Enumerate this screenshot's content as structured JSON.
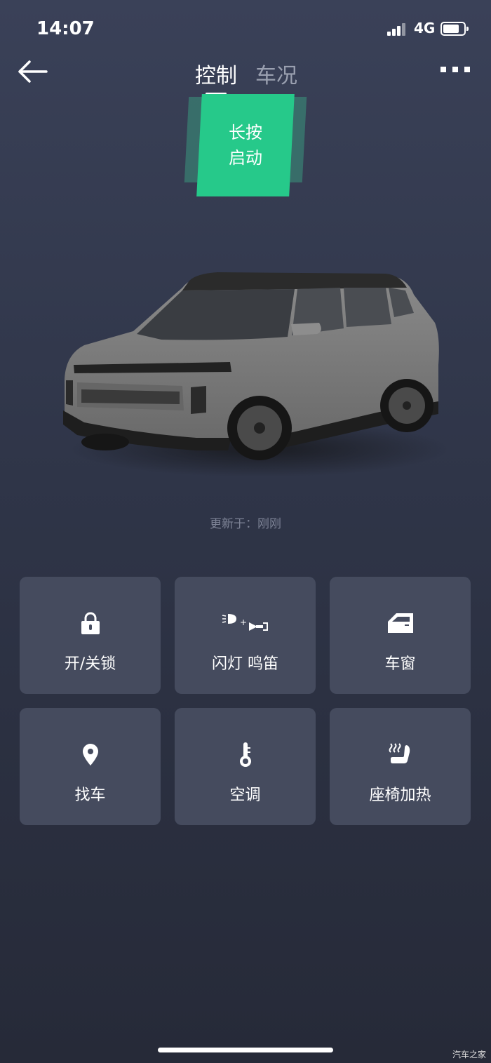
{
  "status": {
    "time": "14:07",
    "network": "4G",
    "battery_level": 0.75
  },
  "nav": {
    "tabs": [
      {
        "label": "控制",
        "active": true
      },
      {
        "label": "车况",
        "active": false
      }
    ]
  },
  "start": {
    "line1": "长按",
    "line2": "启动"
  },
  "updated": "更新于：刚刚",
  "controls": [
    {
      "label": "开/关锁",
      "icon": "lock-icon"
    },
    {
      "label": "闪灯 鸣笛",
      "icon": "flash-horn-icon"
    },
    {
      "label": "车窗",
      "icon": "car-window-icon"
    },
    {
      "label": "找车",
      "icon": "location-pin-icon"
    },
    {
      "label": "空调",
      "icon": "thermometer-icon"
    },
    {
      "label": "座椅加热",
      "icon": "seat-heat-icon"
    }
  ],
  "watermark": "汽车之家",
  "colors": {
    "accent": "#26c98a",
    "card": "#454b5e",
    "background": "#2f3548"
  }
}
